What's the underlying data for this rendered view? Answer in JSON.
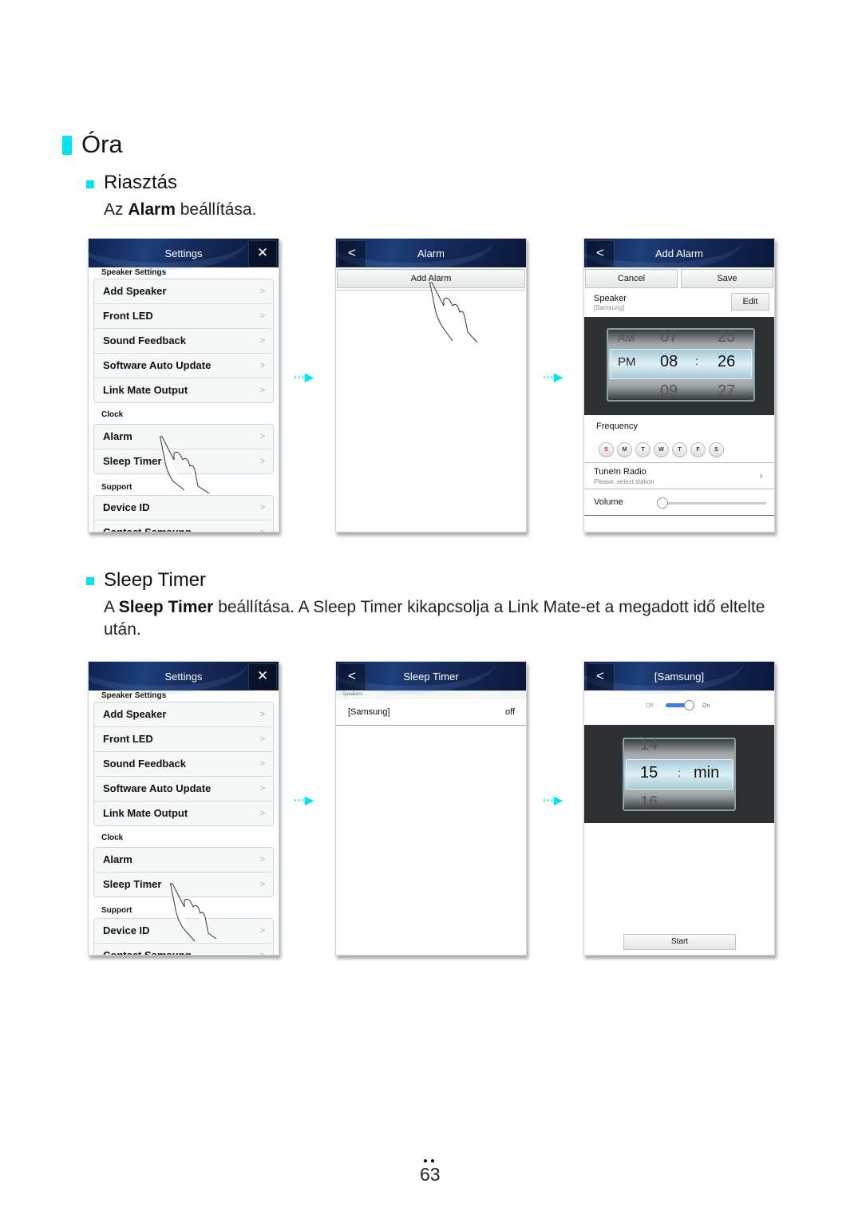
{
  "heading": "Óra",
  "sections": [
    {
      "title": "Riasztás",
      "desc_pre": "Az ",
      "desc_bold": "Alarm",
      "desc_post": " beállítása."
    },
    {
      "title": "Sleep Timer",
      "desc_pre": "A ",
      "desc_bold": "Sleep Timer",
      "desc_post": " beállítása. A Sleep Timer kikapcsolja a Link Mate-et a megadott idő eltelte után."
    }
  ],
  "settings_screen": {
    "title": "Settings",
    "close_icon": "close-icon",
    "section_speaker": "Speaker Settings",
    "speaker_items": [
      "Add Speaker",
      "Front LED",
      "Sound Feedback",
      "Software Auto Update",
      "Link Mate Output"
    ],
    "section_clock": "Clock",
    "clock_items": [
      "Alarm",
      "Sleep Timer"
    ],
    "section_support": "Support",
    "support_items": [
      "Device ID",
      "Contact Samsung"
    ],
    "chevron": ">"
  },
  "alarm_screen": {
    "title": "Alarm",
    "back": "<",
    "add_button": "Add Alarm"
  },
  "add_alarm_screen": {
    "title": "Add Alarm",
    "back": "<",
    "cancel": "Cancel",
    "save": "Save",
    "speaker_label": "Speaker",
    "speaker_value": "[Samsung]",
    "edit": "Edit",
    "picker": {
      "ampm_prev": "AM",
      "ampm": "PM",
      "ampm_next": "",
      "hour_prev": "07",
      "hour": "08",
      "hour_next": "09",
      "min_prev": "25",
      "min": "26",
      "min_next": "27",
      "sep": ":"
    },
    "frequency_label": "Frequency",
    "days": [
      "S",
      "M",
      "T",
      "W",
      "T",
      "F",
      "S"
    ],
    "active_day_color": "#e0201c",
    "tunein_label": "TuneIn Radio",
    "tunein_sub": "Please, select station",
    "volume_label": "Volume",
    "volume_level": 0
  },
  "sleep_list_screen": {
    "title": "Sleep Timer",
    "back": "<",
    "section": "Speakers",
    "row_name": "[Samsung]",
    "row_value": "off"
  },
  "sleep_detail_screen": {
    "title": "[Samsung]",
    "back": "<",
    "toggle_off": "Off",
    "toggle_on": "On",
    "toggle_state": "on",
    "picker": {
      "prev": "14",
      "value": "15",
      "next": "16",
      "sep": ":",
      "unit": "min"
    },
    "start": "Start"
  },
  "page_number": "63",
  "colors": {
    "accent": "#00e5ef",
    "header": "#152a5c"
  }
}
